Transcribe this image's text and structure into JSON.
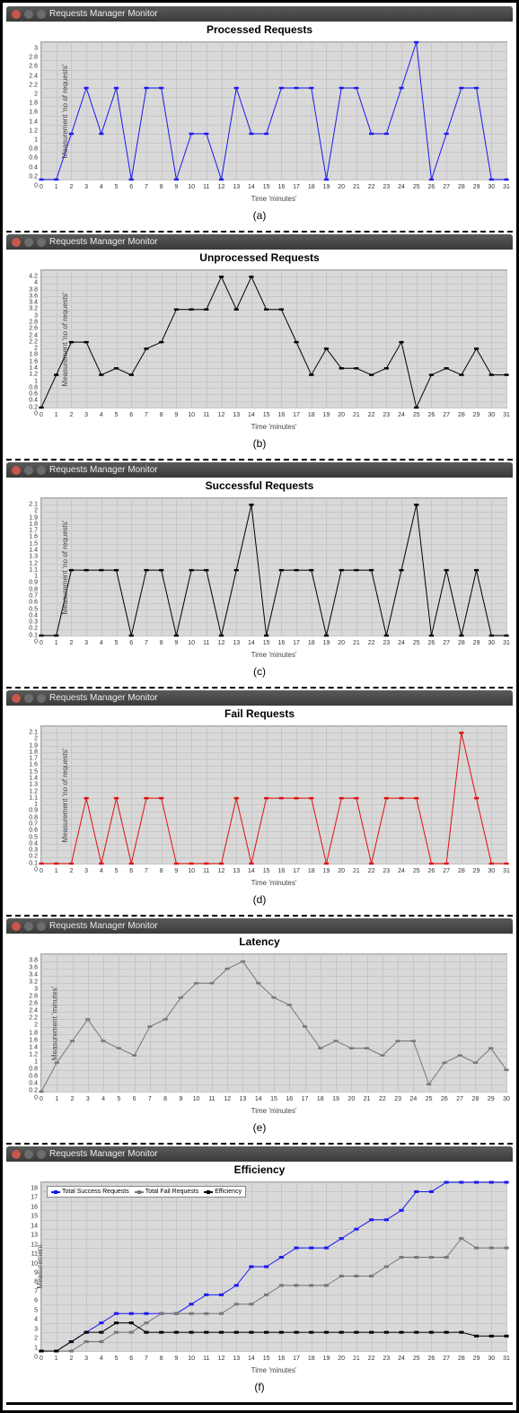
{
  "window_title": "Requests Manager Monitor",
  "panels": {
    "a": {
      "title": "Processed Requests",
      "sub": "(a)",
      "ylabel": "Measurement 'no of requests'",
      "xlabel": "Time 'minutes'"
    },
    "b": {
      "title": "Unprocessed Requests",
      "sub": "(b)",
      "ylabel": "Measurement 'no of requests'",
      "xlabel": "Time 'minutes'"
    },
    "c": {
      "title": "Successful Requests",
      "sub": "(c)",
      "ylabel": "Measurement 'no of requests'",
      "xlabel": "Time 'minutes'"
    },
    "d": {
      "title": "Fail Requests",
      "sub": "(d)",
      "ylabel": "Measurement 'no of requests'",
      "xlabel": "Time 'minutes'"
    },
    "e": {
      "title": "Latency",
      "sub": "(e)",
      "ylabel": "Measurement 'minutes'",
      "xlabel": "Time 'minutes'"
    },
    "f": {
      "title": "Efficiency",
      "sub": "(f)",
      "ylabel": "Measurement",
      "xlabel": "Time 'minutes'"
    }
  },
  "legend_f": [
    "Total Success Requests",
    "Total Fail Requests",
    "Efficiency"
  ],
  "chart_data": [
    {
      "id": "a",
      "type": "line",
      "title": "Processed Requests",
      "xlabel": "Time 'minutes'",
      "ylabel": "Measurement 'no of requests'",
      "ylim": [
        0,
        3.0
      ],
      "yticks": [
        0,
        0.2,
        0.4,
        0.6,
        0.8,
        1.0,
        1.2,
        1.4,
        1.6,
        1.8,
        2.0,
        2.2,
        2.4,
        2.6,
        2.8,
        3.0
      ],
      "x": [
        0,
        1,
        2,
        3,
        4,
        5,
        6,
        7,
        8,
        9,
        10,
        11,
        12,
        13,
        14,
        15,
        16,
        17,
        18,
        19,
        20,
        21,
        22,
        23,
        24,
        25,
        26,
        27,
        28,
        29,
        30,
        31
      ],
      "series": [
        {
          "name": "Processed",
          "color": "#1a1af0",
          "values": [
            0,
            0,
            1,
            2,
            1,
            2,
            0,
            2,
            2,
            0,
            1,
            1,
            0,
            2,
            1,
            1,
            2,
            2,
            2,
            0,
            2,
            2,
            1,
            1,
            2,
            3,
            0,
            1,
            2,
            2,
            0,
            0
          ]
        }
      ]
    },
    {
      "id": "b",
      "type": "line",
      "title": "Unprocessed Requests",
      "xlabel": "Time 'minutes'",
      "ylabel": "Measurement 'no of requests'",
      "ylim": [
        0,
        4.2
      ],
      "yticks": [
        0,
        0.2,
        0.4,
        0.6,
        0.8,
        1.0,
        1.2,
        1.4,
        1.6,
        1.8,
        2.0,
        2.2,
        2.4,
        2.6,
        2.8,
        3.0,
        3.2,
        3.4,
        3.6,
        3.8,
        4.0,
        4.2
      ],
      "x": [
        0,
        1,
        2,
        3,
        4,
        5,
        6,
        7,
        8,
        9,
        10,
        11,
        12,
        13,
        14,
        15,
        16,
        17,
        18,
        19,
        20,
        21,
        22,
        23,
        24,
        25,
        26,
        27,
        28,
        29,
        30,
        31
      ],
      "series": [
        {
          "name": "Unprocessed",
          "color": "#000",
          "values": [
            0,
            1,
            2,
            2,
            1,
            1.2,
            1,
            1.8,
            2,
            3,
            3,
            3,
            4,
            3,
            4,
            3,
            3,
            2,
            1,
            1.8,
            1.2,
            1.2,
            1,
            1.2,
            2,
            0,
            1,
            1.2,
            1,
            1.8,
            1,
            1
          ]
        }
      ]
    },
    {
      "id": "c",
      "type": "line",
      "title": "Successful Requests",
      "xlabel": "Time 'minutes'",
      "ylabel": "Measurement 'no of requests'",
      "ylim": [
        0,
        2.1
      ],
      "yticks": [
        0,
        0.1,
        0.2,
        0.3,
        0.4,
        0.5,
        0.6,
        0.7,
        0.8,
        0.9,
        1.0,
        1.1,
        1.2,
        1.3,
        1.4,
        1.5,
        1.6,
        1.7,
        1.8,
        1.9,
        2.0,
        2.1
      ],
      "x": [
        0,
        1,
        2,
        3,
        4,
        5,
        6,
        7,
        8,
        9,
        10,
        11,
        12,
        13,
        14,
        15,
        16,
        17,
        18,
        19,
        20,
        21,
        22,
        23,
        24,
        25,
        26,
        27,
        28,
        29,
        30,
        31
      ],
      "series": [
        {
          "name": "Successful",
          "color": "#000",
          "values": [
            0,
            0,
            1,
            1,
            1,
            1,
            0,
            1,
            1,
            0,
            1,
            1,
            0,
            1,
            2,
            0,
            1,
            1,
            1,
            0,
            1,
            1,
            1,
            0,
            1,
            2,
            0,
            1,
            0,
            1,
            0,
            0
          ]
        }
      ]
    },
    {
      "id": "d",
      "type": "line",
      "title": "Fail Requests",
      "xlabel": "Time 'minutes'",
      "ylabel": "Measurement 'no of requests'",
      "ylim": [
        0,
        2.1
      ],
      "yticks": [
        0,
        0.1,
        0.2,
        0.3,
        0.4,
        0.5,
        0.6,
        0.7,
        0.8,
        0.9,
        1.0,
        1.1,
        1.2,
        1.3,
        1.4,
        1.5,
        1.6,
        1.7,
        1.8,
        1.9,
        2.0,
        2.1
      ],
      "x": [
        0,
        1,
        2,
        3,
        4,
        5,
        6,
        7,
        8,
        9,
        10,
        11,
        12,
        13,
        14,
        15,
        16,
        17,
        18,
        19,
        20,
        21,
        22,
        23,
        24,
        25,
        26,
        27,
        28,
        29,
        30,
        31
      ],
      "series": [
        {
          "name": "Fail",
          "color": "#e01010",
          "values": [
            0,
            0,
            0,
            1,
            0,
            1,
            0,
            1,
            1,
            0,
            0,
            0,
            0,
            1,
            0,
            1,
            1,
            1,
            1,
            0,
            1,
            1,
            0,
            1,
            1,
            1,
            0,
            0,
            2,
            1,
            0,
            0
          ]
        }
      ]
    },
    {
      "id": "e",
      "type": "line",
      "title": "Latency",
      "xlabel": "Time 'minutes'",
      "ylabel": "Measurement 'minutes'",
      "ylim": [
        0,
        3.8
      ],
      "yticks": [
        0,
        0.2,
        0.4,
        0.6,
        0.8,
        1.0,
        1.2,
        1.4,
        1.6,
        1.8,
        2.0,
        2.2,
        2.4,
        2.6,
        2.8,
        3.0,
        3.2,
        3.4,
        3.6,
        3.8
      ],
      "x": [
        0,
        1,
        2,
        3,
        4,
        5,
        6,
        7,
        8,
        9,
        10,
        11,
        12,
        13,
        14,
        15,
        16,
        17,
        18,
        19,
        20,
        21,
        22,
        23,
        24,
        25,
        26,
        27,
        28,
        29,
        30
      ],
      "series": [
        {
          "name": "Latency",
          "color": "#777",
          "values": [
            0,
            0.8,
            1.4,
            2,
            1.4,
            1.2,
            1,
            1.8,
            2,
            2.6,
            3,
            3,
            3.4,
            3.6,
            3,
            2.6,
            2.4,
            1.8,
            1.2,
            1.4,
            1.2,
            1.2,
            1,
            1.4,
            1.4,
            0.2,
            0.8,
            1,
            0.8,
            1.2,
            0.6
          ]
        }
      ]
    },
    {
      "id": "f",
      "type": "line",
      "title": "Efficiency",
      "xlabel": "Time 'minutes'",
      "ylabel": "Measurement",
      "ylim": [
        0,
        18
      ],
      "yticks": [
        0,
        1,
        2,
        3,
        4,
        5,
        6,
        7,
        8,
        9,
        10,
        11,
        12,
        13,
        14,
        15,
        16,
        17,
        18
      ],
      "x": [
        0,
        1,
        2,
        3,
        4,
        5,
        6,
        7,
        8,
        9,
        10,
        11,
        12,
        13,
        14,
        15,
        16,
        17,
        18,
        19,
        20,
        21,
        22,
        23,
        24,
        25,
        26,
        27,
        28,
        29,
        30,
        31
      ],
      "legend": [
        "Total Success Requests",
        "Total Fail Requests",
        "Efficiency"
      ],
      "series": [
        {
          "name": "Total Success Requests",
          "color": "#1a1af0",
          "values": [
            0,
            0,
            1,
            2,
            3,
            4,
            4,
            4,
            4,
            4,
            5,
            6,
            6,
            7,
            9,
            9,
            10,
            11,
            11,
            11,
            12,
            13,
            14,
            14,
            15,
            17,
            17,
            18,
            18,
            18,
            18,
            18
          ]
        },
        {
          "name": "Total Fail Requests",
          "color": "#777",
          "values": [
            0,
            0,
            0,
            1,
            1,
            2,
            2,
            3,
            4,
            4,
            4,
            4,
            4,
            5,
            5,
            6,
            7,
            7,
            7,
            7,
            8,
            8,
            8,
            9,
            10,
            10,
            10,
            10,
            12,
            11,
            11,
            11
          ]
        },
        {
          "name": "Efficiency",
          "color": "#000",
          "values": [
            0,
            0,
            1,
            2,
            2,
            3,
            3,
            2,
            2,
            2,
            2,
            2,
            2,
            2,
            2,
            2,
            2,
            2,
            2,
            2,
            2,
            2,
            2,
            2,
            2,
            2,
            2,
            2,
            2,
            1.6,
            1.6,
            1.6
          ]
        }
      ]
    }
  ]
}
